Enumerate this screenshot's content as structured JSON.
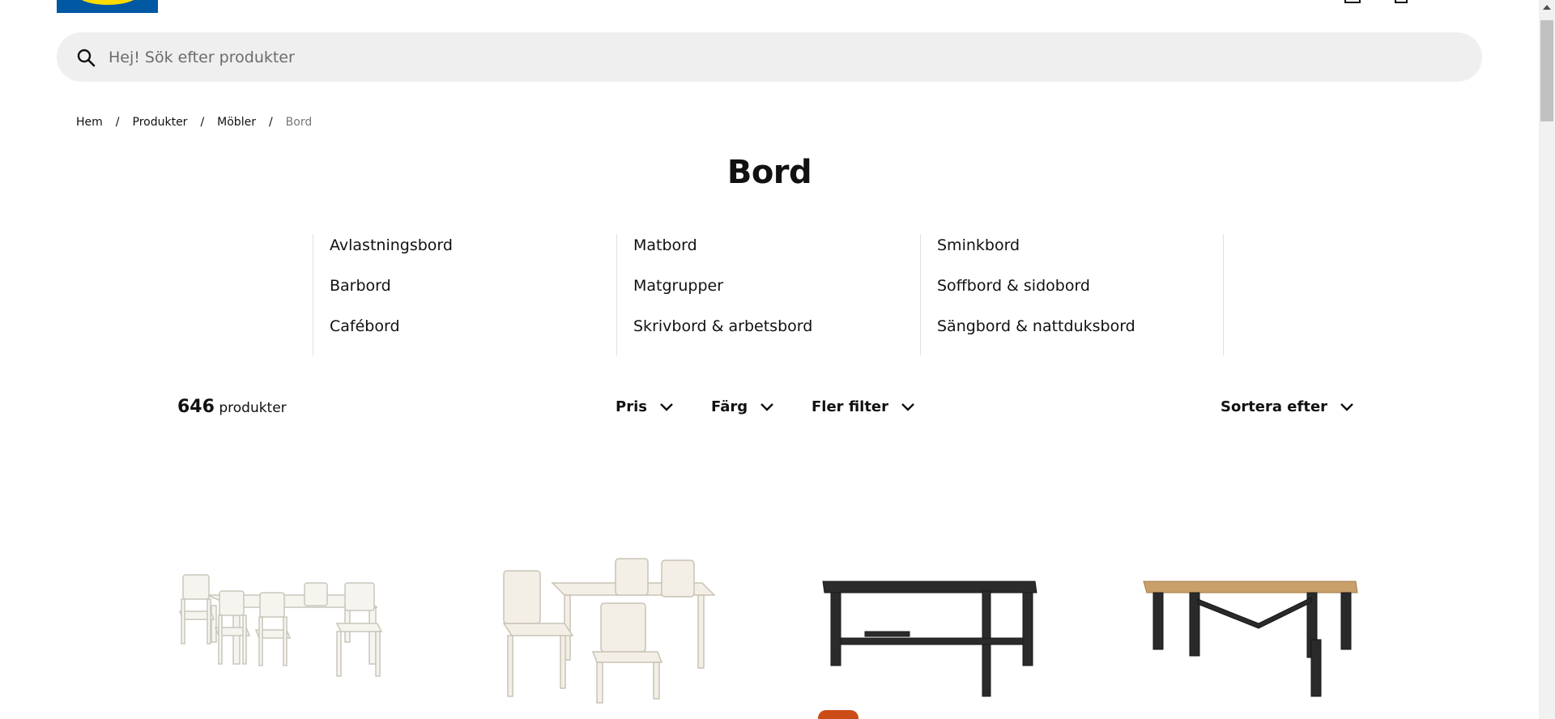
{
  "search": {
    "placeholder": "Hej! Sök efter produkter"
  },
  "breadcrumb": [
    {
      "label": "Hem"
    },
    {
      "label": "Produkter"
    },
    {
      "label": "Möbler"
    },
    {
      "label": "Bord"
    }
  ],
  "page_title": "Bord",
  "categories": [
    [
      "Avlastningsbord",
      "Barbord",
      "Cafébord"
    ],
    [
      "Matbord",
      "Matgrupper",
      "Skrivbord & arbetsbord"
    ],
    [
      "Sminkbord",
      "Soffbord & sidobord",
      "Sängbord & nattduksbord"
    ]
  ],
  "results": {
    "count": "646",
    "unit": "produkter"
  },
  "filters": [
    {
      "label": "Pris"
    },
    {
      "label": "Färg"
    },
    {
      "label": "Fler filter"
    }
  ],
  "sort": {
    "label": "Sortera efter"
  },
  "colors": {
    "logo_blue": "#0058a3",
    "logo_yellow": "#ffdb00",
    "badge": "#cc4c17",
    "search_bg": "#efefef"
  },
  "icons": [
    "search-icon",
    "chevron-down-icon",
    "user-icon",
    "cart-icon"
  ]
}
